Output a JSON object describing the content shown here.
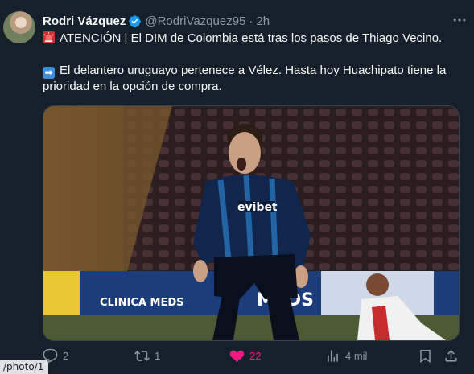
{
  "tweet": {
    "author_name": "Rodri Vázquez",
    "handle": "@RodriVazquez95",
    "separator": "·",
    "time": "2h",
    "line1": "ATENCIÓN | El DIM de Colombia está tras los pasos de Thiago Vecino.",
    "line2_a": "El delantero uruguayo pertenece a Vélez. Hasta hoy Huachipato tiene la",
    "line2_b": "prioridad en la opción de compra.",
    "line1_emoji": "siren-emoji",
    "line2_emoji": "right-arrow-emoji"
  },
  "media": {
    "jersey_sponsor": "evibet",
    "board_left": "CLINICA MEDS",
    "board_right": "MEDS"
  },
  "actions": {
    "replies": "2",
    "reposts": "1",
    "likes": "22",
    "views": "4 mil"
  },
  "status_bar": {
    "url": "/photo/1"
  },
  "colors": {
    "background": "#15202b",
    "text": "#f7f9f9",
    "muted": "#8b98a5",
    "verified": "#1d9bf0",
    "like": "#f91880"
  }
}
